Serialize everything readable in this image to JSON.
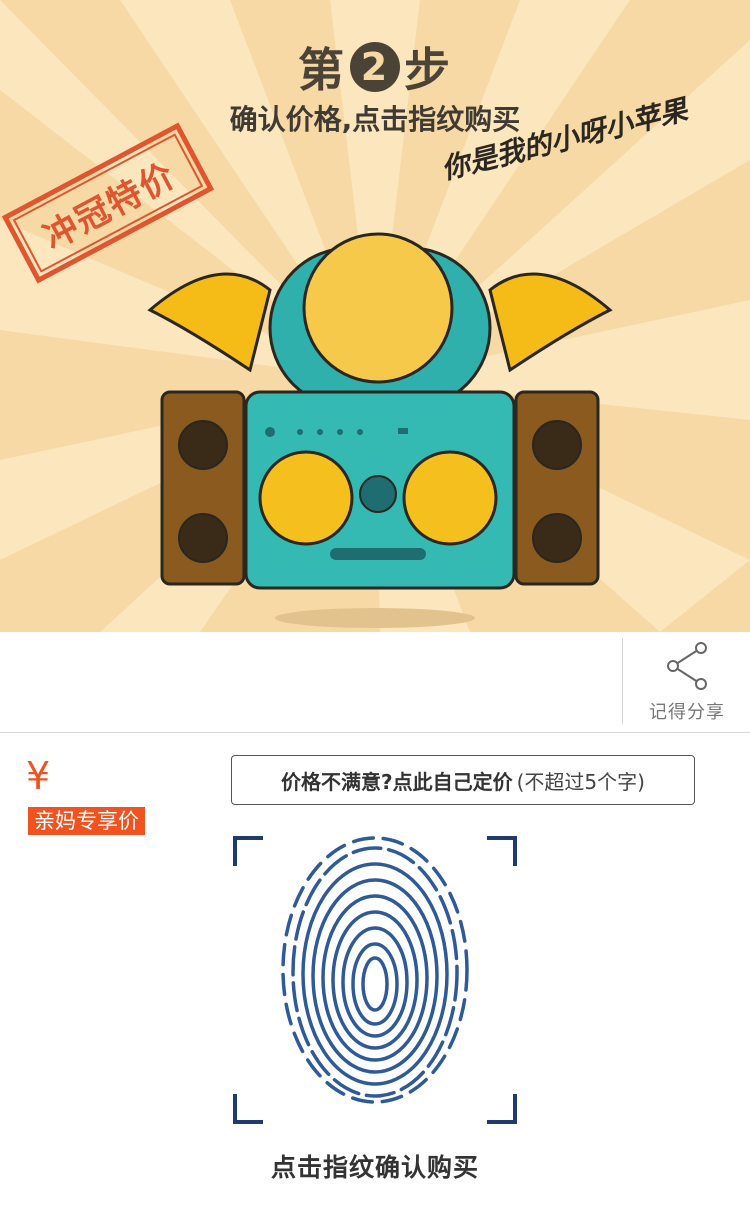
{
  "hero": {
    "step_prefix": "第",
    "step_number": "2",
    "step_suffix": "步",
    "subtitle": "确认价格,点击指纹购买",
    "stamp_text": "冲冠特价",
    "scribble_text": "你是我的小呀小苹果"
  },
  "share": {
    "label": "记得分享",
    "icon": "share-icon"
  },
  "price": {
    "currency_symbol": "¥",
    "tag_label": "亲妈专享价"
  },
  "custom_price": {
    "label": "价格不满意?点此自己定价",
    "hint": "(不超过5个字)"
  },
  "fingerprint": {
    "icon": "fingerprint-icon",
    "caption": "点击指纹确认购买"
  },
  "colors": {
    "accent": "#f0531f",
    "hero_bg": "#f6d9a4",
    "fingerprint": "#2e5a9a",
    "frame": "#1e3a6e"
  }
}
